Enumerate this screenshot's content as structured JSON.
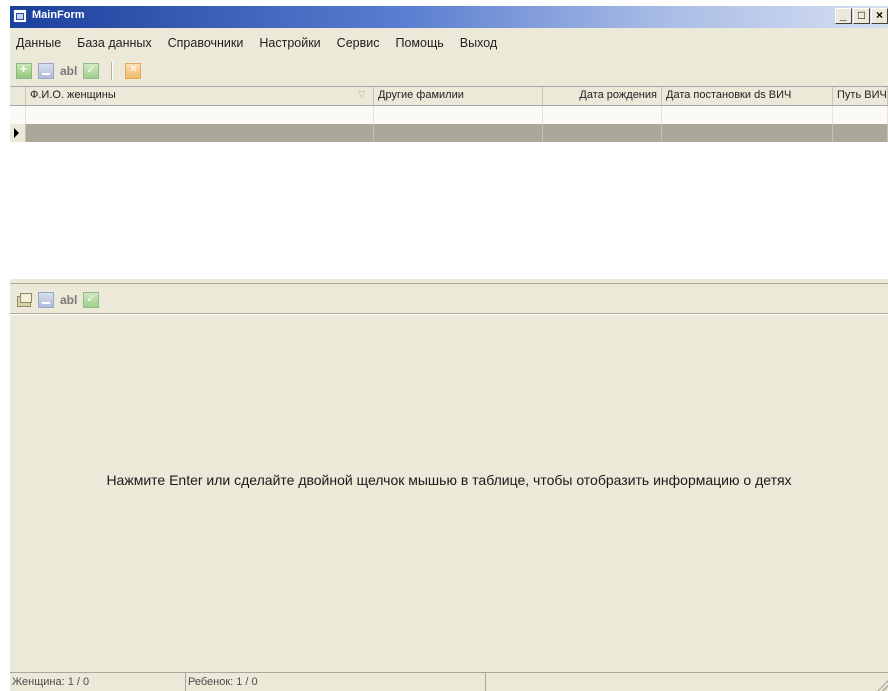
{
  "window": {
    "title": "MainForm",
    "min_label": "_",
    "max_label": "□",
    "close_label": "×"
  },
  "menu": [
    "Данные",
    "База данных",
    "Справочники",
    "Настройки",
    "Сервис",
    "Помощь",
    "Выход"
  ],
  "main_toolbar": {
    "edit_label": "abl"
  },
  "grid": {
    "columns": [
      "Ф.И.О. женщины",
      "Другие фамилии",
      "Дата рождения",
      "Дата постановки ds ВИЧ",
      "Путь ВИЧ"
    ]
  },
  "detail_toolbar": {
    "edit_label": "abl"
  },
  "message": "Нажмите Enter или сделайте двойной щелчок мышью в таблице, чтобы отобразить информацию о детях",
  "status": {
    "woman": "Женщина: 1 / 0",
    "child": "Ребенок: 1 / 0"
  },
  "icons": [
    "add-icon",
    "delete-icon",
    "edit-icon",
    "save-icon",
    "cancel-icon",
    "open-folder-icon",
    "row-pointer-icon"
  ]
}
